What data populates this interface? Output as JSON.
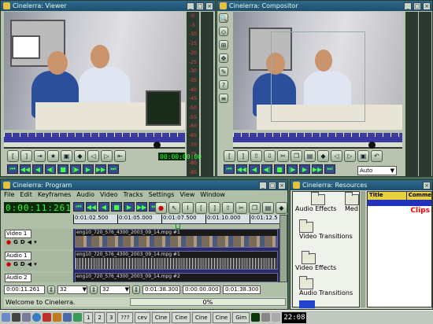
{
  "viewer": {
    "title": "Cinelerra: Viewer",
    "meter_ticks": [
      "0",
      "-5",
      "-10",
      "-15",
      "-20",
      "-25",
      "-30",
      "-35",
      "-40",
      "-45",
      "-50",
      "-55",
      "-60",
      "-65",
      "-70",
      "-75",
      "-80",
      "-85"
    ],
    "timecode": "00:00:00:00"
  },
  "compositor": {
    "title": "Cinelerra: Compositor",
    "zoom": "Auto"
  },
  "program": {
    "title": "Cinelerra: Program",
    "menu": [
      "File",
      "Edit",
      "Keyframes",
      "Audio",
      "Video",
      "Tracks",
      "Settings",
      "View",
      "Window"
    ],
    "clock": "0:00:11:261",
    "ruler": [
      "0:01:02.500",
      "0:01:05.000",
      "0:01:07.500",
      "0:01:10.000",
      "0:01:12.5"
    ],
    "tracks": [
      {
        "name": "Video 1",
        "clip": "eng10_720_576_4300_2003_09_14.mpg #1"
      },
      {
        "name": "Audio 1",
        "clip": "eng10_720_576_4300_2003_09_14.mpg #1"
      },
      {
        "name": "Audio 2",
        "clip": "eng10_720_576_4300_2003_09_14.mpg #2"
      }
    ],
    "track_btn_g": "G",
    "track_btn_d": "D",
    "zoom_time": "0:00:11.261",
    "zoom_samples": "32",
    "zoom_tracks": "32",
    "sel_start": "0:01:38.300",
    "sel_len": "0:00:00.000",
    "sel_end": "0:01:38.300",
    "status": "Welcome to Cinelerra.",
    "progress": "0%"
  },
  "resources": {
    "title": "Cinelerra: Resources",
    "folders": [
      "Audio Effects",
      "Med",
      "Video Transitions",
      "Video Effects",
      "Audio Transitions"
    ],
    "columns": [
      "Title",
      "Comme"
    ],
    "clips_label": "Clips"
  },
  "taskbar": {
    "pages": [
      "1",
      "2",
      "3"
    ],
    "qmarks": "???",
    "items": [
      "cev",
      "Cine",
      "Cine",
      "Cine",
      "Cine",
      "Gim"
    ],
    "clock": "22:08"
  },
  "colors": {
    "accent": "#1f4e6e",
    "timeline": "#3a3aa0",
    "clips_red": "#ff0000"
  }
}
